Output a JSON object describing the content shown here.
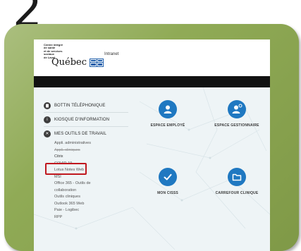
{
  "step_number": "2",
  "header": {
    "org_lines": [
      "Centre intégré",
      "de santé",
      "et de services sociaux",
      "de Laval"
    ],
    "quebec_logo": "Québec",
    "intranet_label": "Intranet"
  },
  "menu": {
    "items": [
      {
        "label": "BOTTIN TÉLÉPHONIQUE",
        "icon": "phonebook-icon"
      },
      {
        "label": "KIOSQUE D'INFORMATION",
        "icon": "info-icon"
      },
      {
        "label": "MES OUTILS DE TRAVAIL",
        "icon": "tools-icon"
      }
    ],
    "subitems": [
      "Appli. administratives",
      "Appli. cliniques",
      "Citrix",
      "COVID-19",
      "Lotus Notes Web",
      "MSI",
      "Office 365 - Outils de collaboration",
      "Outils cliniques",
      "Outlook 365 Web",
      "Paie - Logibec",
      "RPP"
    ]
  },
  "tiles": [
    {
      "label": "ESPACE EMPLOYÉ",
      "icon": "user-icon"
    },
    {
      "label": "ESPACE GESTIONNAIRE",
      "icon": "manager-icon"
    },
    {
      "label": "MON CISSS",
      "icon": "check-icon"
    },
    {
      "label": "CARREFOUR CLINIQUE",
      "icon": "folder-icon"
    }
  ],
  "colors": {
    "panel": "#8aa64d",
    "highlight_box": "#c0181f",
    "tile_icon": "#1f78c1"
  }
}
